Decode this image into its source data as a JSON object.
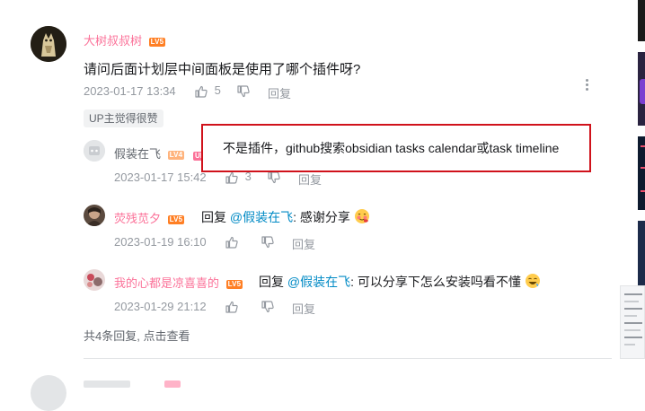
{
  "main_comment": {
    "username": "大树叔叔树",
    "level": "LV5",
    "text": "请问后面计划层中间面板是使用了哪个插件呀?",
    "time": "2023-01-17 13:34",
    "likes": "5",
    "reply_label": "回复",
    "tag": "UP主觉得很赞"
  },
  "replies": [
    {
      "username": "假装在飞",
      "level": "LV4",
      "up_badge": "UP",
      "text": "不是插件，github搜索obsidian tasks calendar或task timeline",
      "time": "2023-01-17 15:42",
      "likes": "3",
      "reply_label": "回复"
    },
    {
      "username": "荧残苋夕",
      "level": "LV5",
      "reply_prefix": "回复",
      "mention": "@假装在飞",
      "text": ": 感谢分享",
      "time": "2023-01-19 16:10",
      "reply_label": "回复"
    },
    {
      "username": "我的心都是凉喜喜的",
      "level": "LV5",
      "reply_prefix": "回复",
      "mention": "@假装在飞",
      "text": ": 可以分享下怎么安装吗看不懂",
      "time": "2023-01-29 21:12",
      "reply_label": "回复"
    }
  ],
  "reply_summary": "共4条回复, 点击查看",
  "colors": {
    "username_pink": "#fb7299",
    "mention_blue": "#008ac5",
    "meta_gray": "#9499a0",
    "callout_red": "#d0121b"
  }
}
